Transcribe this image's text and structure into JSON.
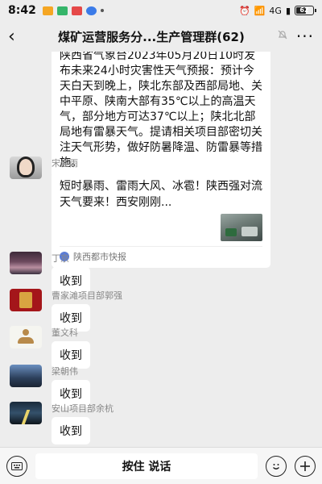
{
  "status": {
    "time": "8:42",
    "network": "4G",
    "battery_percent": 62,
    "battery_text": "62",
    "icons": [
      "mail-app-icon",
      "bank-app-icon",
      "alert-app-icon",
      "pay-app-icon",
      "dot-icon"
    ],
    "right_icons": [
      "alarm-icon",
      "wifi-icon",
      "signal-icon"
    ]
  },
  "nav": {
    "back_icon": "‹",
    "title": "煤矿运营服务分...生产管理群(62)",
    "mute_icon": "bell-off-icon",
    "more_icon": "···"
  },
  "messages": {
    "top_bubble_text": "陕西省气象台2023年05月20日10时发布未来24小时灾害性天气预报：预计今天白天到晚上，陕北东部及西部局地、关中平原、陕南大部有35℃以上的高温天气，部分地方可达37℃以上；陕北北部局地有雷暴天气。提请相关项目部密切关注天气形势，做好防暑降温、防雷暴等措施。",
    "items": [
      {
        "sender": "宋佳雨",
        "type": "card",
        "card_title": "短时暴雨、雷雨大风、冰雹！陕西强对流天气要来！西安刚刚...",
        "card_source": "陕西都市快报"
      },
      {
        "sender": "丁京",
        "type": "text",
        "text": "收到"
      },
      {
        "sender": "曹家滩项目部郭强",
        "type": "text",
        "text": "收到"
      },
      {
        "sender": "董文科",
        "type": "text",
        "text": "收到"
      },
      {
        "sender": "梁朝伟",
        "type": "text",
        "text": "收到"
      },
      {
        "sender": "安山项目部余杭",
        "type": "text",
        "text": "收到"
      }
    ]
  },
  "input_bar": {
    "keyboard_icon": "keyboard-icon",
    "voice_label": "按住 说话",
    "emoji_icon": "smile-icon",
    "plus_icon": "plus-icon"
  },
  "colors": {
    "background": "#ededed",
    "bubble": "#ffffff",
    "sender_text": "#888888"
  }
}
